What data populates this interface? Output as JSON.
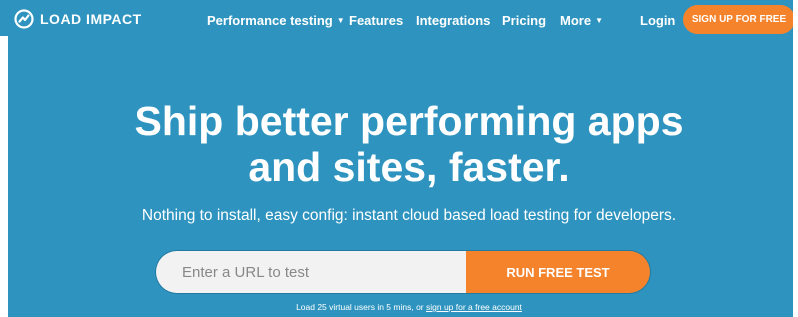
{
  "nav": {
    "logo_text": "LOAD IMPACT",
    "links": [
      {
        "label": "Performance testing",
        "has_caret": true
      },
      {
        "label": "Features",
        "has_caret": false
      },
      {
        "label": "Integrations",
        "has_caret": false
      },
      {
        "label": "Pricing",
        "has_caret": false
      },
      {
        "label": "More",
        "has_caret": true
      }
    ],
    "login_label": "Login",
    "signup_label": "SIGN UP FOR FREE"
  },
  "hero": {
    "headline_line1": "Ship better performing apps",
    "headline_line2": "and sites, faster.",
    "subheadline": "Nothing to install, easy config: instant cloud based load testing for developers."
  },
  "form": {
    "url_placeholder": "Enter a URL to test",
    "url_value": "",
    "run_button_label": "RUN FREE TEST"
  },
  "footnote": {
    "text": "Load 25 virtual users in 5 mins, or",
    "link_label": "sign up for a free account"
  },
  "colors": {
    "hero_background": "#2e94bf",
    "accent_orange": "#f5832b"
  }
}
